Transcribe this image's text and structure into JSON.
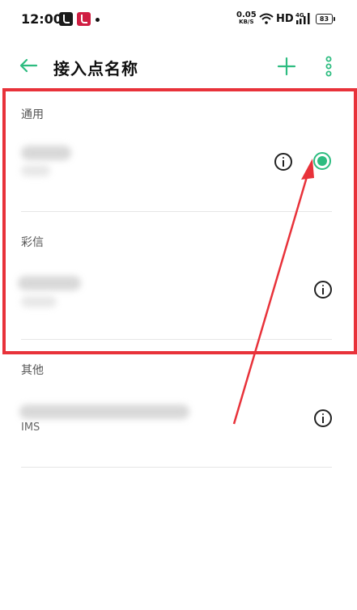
{
  "status_bar": {
    "time": "12:00",
    "net_speed_value": "0.05",
    "net_speed_unit": "KB/S",
    "hd": "HD",
    "signal_type": "4G",
    "battery": "83"
  },
  "header": {
    "title": "接入点名称",
    "back_icon": "arrow-left-icon",
    "add_icon": "plus-icon",
    "menu_icon": "more-vertical-icon"
  },
  "sections": [
    {
      "label": "通用",
      "items": [
        {
          "name": "",
          "subtitle": "",
          "selected": true
        }
      ]
    },
    {
      "label": "彩信",
      "items": [
        {
          "name": "",
          "subtitle": "",
          "selected": false
        }
      ]
    },
    {
      "label": "其他",
      "items": [
        {
          "name": "",
          "subtitle": "IMS",
          "selected": false
        }
      ]
    }
  ],
  "colors": {
    "accent": "#2dbc80",
    "highlight": "#e8323a"
  }
}
